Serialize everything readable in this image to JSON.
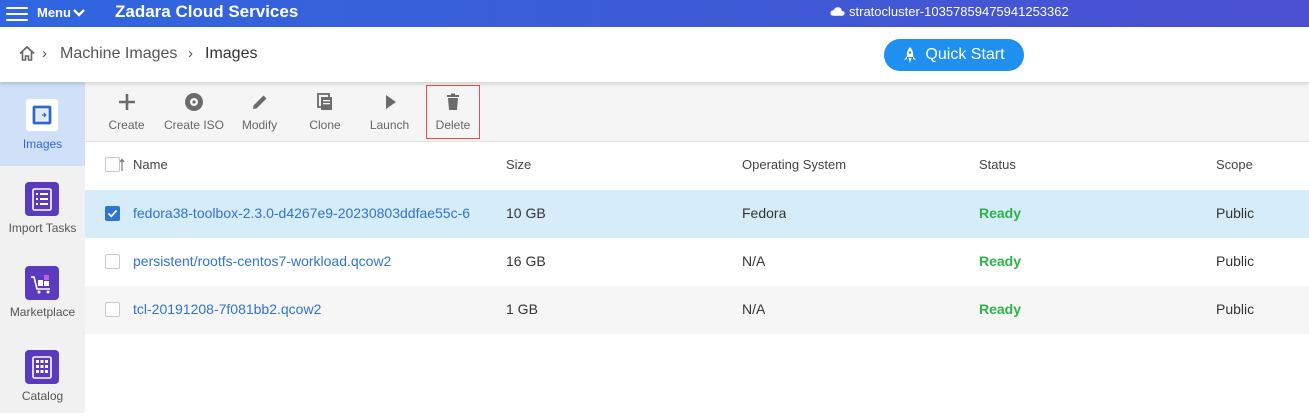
{
  "header": {
    "menu_label": "Menu",
    "title": "Zadara Cloud Services",
    "cluster": "stratocluster-10357859475941253362"
  },
  "breadcrumb": {
    "items": [
      "Machine Images",
      "Images"
    ]
  },
  "quick_start": "Quick Start",
  "sidebar": {
    "items": [
      {
        "label": "Images",
        "icon": "images-icon",
        "active": true
      },
      {
        "label": "Import Tasks",
        "icon": "import-tasks-icon",
        "active": false
      },
      {
        "label": "Marketplace",
        "icon": "marketplace-icon",
        "active": false
      },
      {
        "label": "Catalog",
        "icon": "catalog-icon",
        "active": false
      }
    ]
  },
  "toolbar": {
    "buttons": [
      {
        "label": "Create",
        "icon": "plus-icon"
      },
      {
        "label": "Create ISO",
        "icon": "disc-icon"
      },
      {
        "label": "Modify",
        "icon": "pencil-icon"
      },
      {
        "label": "Clone",
        "icon": "copy-icon"
      },
      {
        "label": "Launch",
        "icon": "play-icon"
      },
      {
        "label": "Delete",
        "icon": "trash-icon"
      }
    ]
  },
  "table": {
    "columns": [
      "Name",
      "Size",
      "Operating System",
      "Status",
      "Scope"
    ],
    "rows": [
      {
        "name": "fedora38-toolbox-2.3.0-d4267e9-20230803ddfae55c-6",
        "size": "10 GB",
        "os": "Fedora",
        "status": "Ready",
        "scope": "Public",
        "selected": true
      },
      {
        "name": "persistent/rootfs-centos7-workload.qcow2",
        "size": "16 GB",
        "os": "N/A",
        "status": "Ready",
        "scope": "Public",
        "selected": false
      },
      {
        "name": "tcl-20191208-7f081bb2.qcow2",
        "size": "1 GB",
        "os": "N/A",
        "status": "Ready",
        "scope": "Public",
        "selected": false
      }
    ]
  },
  "colors": {
    "header_gradient_start": "#2f66e0",
    "header_gradient_end": "#4b4fd2",
    "accent": "#1f8ff0",
    "link": "#2f74d0",
    "status_ready": "#2db34a",
    "selected_row": "#d6ecf9",
    "delete_outline": "#d9534f"
  }
}
